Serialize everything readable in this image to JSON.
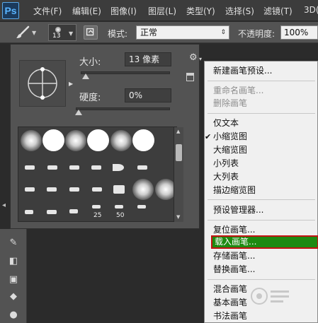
{
  "app": {
    "logo": "Ps"
  },
  "menubar": {
    "items": [
      "文件(F)",
      "编辑(E)",
      "图像(I)",
      "图层(L)",
      "类型(Y)",
      "选择(S)",
      "滤镜(T)",
      "3D("
    ]
  },
  "options_bar": {
    "tool_icon": "brush-icon",
    "brush_size": "13",
    "mode_label": "模式:",
    "mode_value": "正常",
    "opacity_label": "不透明度:",
    "opacity_value": "100%"
  },
  "brush_panel": {
    "size_label": "大小:",
    "size_value": "13 像素",
    "size_fraction": 0.02,
    "hardness_label": "硬度:",
    "hardness_value": "0%",
    "hardness_fraction": 0.0,
    "preset_numbers": [
      "25",
      "50"
    ],
    "settings_icon": "gear-icon"
  },
  "context_menu": {
    "items": [
      {
        "label": "新建画笔预设...",
        "state": "normal"
      },
      {
        "label": "重命名画笔...",
        "state": "disabled"
      },
      {
        "label": "删除画笔",
        "state": "disabled"
      },
      {
        "label": "仅文本",
        "state": "normal"
      },
      {
        "label": "小缩览图",
        "state": "checked"
      },
      {
        "label": "大缩览图",
        "state": "normal"
      },
      {
        "label": "小列表",
        "state": "normal"
      },
      {
        "label": "大列表",
        "state": "normal"
      },
      {
        "label": "描边缩览图",
        "state": "normal"
      },
      {
        "label": "预设管理器...",
        "state": "normal"
      },
      {
        "label": "复位画笔...",
        "state": "normal"
      },
      {
        "label": "载入画笔...",
        "state": "highlighted"
      },
      {
        "label": "存储画笔...",
        "state": "normal"
      },
      {
        "label": "替换画笔...",
        "state": "normal"
      },
      {
        "label": "混合画笔",
        "state": "normal"
      },
      {
        "label": "基本画笔",
        "state": "normal"
      },
      {
        "label": "书法画笔",
        "state": "normal"
      }
    ]
  },
  "colors": {
    "highlight_bg": "#1e8a12",
    "highlight_border": "#c21212",
    "menu_bg": "#f0f0f0",
    "panel_bg": "#535353"
  }
}
